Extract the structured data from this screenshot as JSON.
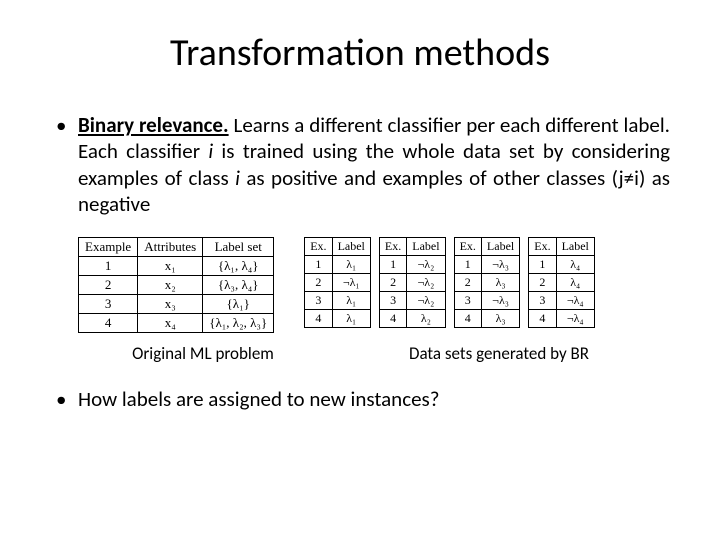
{
  "title": "Transformation methods",
  "bullet1": {
    "lead": "Binary relevance.",
    "p1": " Learns a different classifier per each different label. Each classifier ",
    "i1": "i",
    "p2": " is trained using the whole data set by considering examples of class ",
    "i2": "i",
    "p3": " as positive and examples of other classes (j≠i) as negative"
  },
  "original_table": {
    "h1": "Example",
    "h2": "Attributes",
    "h3": "Label set",
    "r1c1": "1",
    "r1c2": "x₁",
    "r1c3": "{λ₁, λ₄}",
    "r2c1": "2",
    "r2c2": "x₂",
    "r2c3": "{λ₃, λ₄}",
    "r3c1": "3",
    "r3c2": "x₃",
    "r3c3": "{λ₁}",
    "r4c1": "4",
    "r4c2": "x₄",
    "r4c3": "{λ₁, λ₂, λ₃}"
  },
  "br_tables": [
    {
      "h1": "Ex.",
      "h2": "Label",
      "rows": [
        "1",
        "λ₁",
        "2",
        "¬λ₁",
        "3",
        "λ₁",
        "4",
        "λ₁"
      ]
    },
    {
      "h1": "Ex.",
      "h2": "Label",
      "rows": [
        "1",
        "¬λ₂",
        "2",
        "¬λ₂",
        "3",
        "¬λ₂",
        "4",
        "λ₂"
      ]
    },
    {
      "h1": "Ex.",
      "h2": "Label",
      "rows": [
        "1",
        "¬λ₃",
        "2",
        "λ₃",
        "3",
        "¬λ₃",
        "4",
        "λ₃"
      ]
    },
    {
      "h1": "Ex.",
      "h2": "Label",
      "rows": [
        "1",
        "λ₄",
        "2",
        "λ₄",
        "3",
        "¬λ₄",
        "4",
        "¬λ₄"
      ]
    }
  ],
  "caption_left": "Original ML problem",
  "caption_right": "Data sets generated by BR",
  "bullet2": "How labels are assigned to new instances?"
}
